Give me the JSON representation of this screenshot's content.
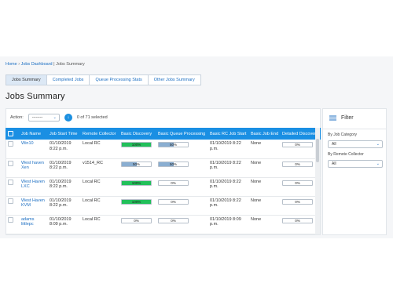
{
  "breadcrumb": {
    "home": "Home",
    "sep1": " › ",
    "dashboard": "Jobs Dashboard",
    "sep2": " | ",
    "current": "Jobs Summary"
  },
  "tabs": [
    {
      "label": "Jobs Summary"
    },
    {
      "label": "Completed Jobs"
    },
    {
      "label": "Queue Processing Stats"
    },
    {
      "label": "Other Jobs Summary"
    }
  ],
  "page_title": "Jobs Summary",
  "actionbar": {
    "label": "Action:",
    "select_value": "--------",
    "selected_text": "0 of 71 selected"
  },
  "table": {
    "columns": [
      "Job Name",
      "Job Start Time",
      "Remote Collector",
      "Basic Discovery",
      "Basic Queue Processing",
      "Basic RC Job Start",
      "Basic Job End",
      "Detailed Discovery"
    ],
    "rows": [
      {
        "name": "Win10",
        "start": "01/10/2019 8:22 p.m.",
        "collector": "Local RC",
        "basic_discovery": {
          "label": "100%",
          "value": 100,
          "color": "green"
        },
        "queue": {
          "label": "50%",
          "value": 50,
          "color": "blue"
        },
        "rc_start": "01/10/2019 8:22 p.m.",
        "job_end": "None",
        "detailed": {
          "label": "0%",
          "value": 0,
          "color": "blue"
        }
      },
      {
        "name": "West haven Xen",
        "start": "01/10/2019 8:22 p.m.",
        "collector": "v1514_RC",
        "basic_discovery": {
          "label": "50%",
          "value": 50,
          "color": "blue"
        },
        "queue": {
          "label": "50%",
          "value": 50,
          "color": "blue"
        },
        "rc_start": "01/10/2019 8:22 p.m.",
        "job_end": "None",
        "detailed": {
          "label": "0%",
          "value": 0,
          "color": "blue"
        }
      },
      {
        "name": "West Haven LXC",
        "start": "01/10/2019 8:22 p.m.",
        "collector": "Local RC",
        "basic_discovery": {
          "label": "100%",
          "value": 100,
          "color": "green"
        },
        "queue": {
          "label": "0%",
          "value": 0,
          "color": "blue"
        },
        "rc_start": "01/10/2019 8:22 p.m.",
        "job_end": "None",
        "detailed": {
          "label": "0%",
          "value": 0,
          "color": "blue"
        }
      },
      {
        "name": "West Haven KVM",
        "start": "01/10/2019 8:22 p.m.",
        "collector": "Local RC",
        "basic_discovery": {
          "label": "100%",
          "value": 100,
          "color": "green"
        },
        "queue": {
          "label": "0%",
          "value": 0,
          "color": "blue"
        },
        "rc_start": "01/10/2019 8:22 p.m.",
        "job_end": "None",
        "detailed": {
          "label": "0%",
          "value": 0,
          "color": "blue"
        }
      },
      {
        "name": "adams littlepc",
        "start": "01/10/2019 8:09 p.m.",
        "collector": "Local RC",
        "basic_discovery": {
          "label": "0%",
          "value": 0,
          "color": "blue"
        },
        "queue": {
          "label": "0%",
          "value": 0,
          "color": "blue"
        },
        "rc_start": "01/10/2019 8:09 p.m.",
        "job_end": "None",
        "detailed": {
          "label": "0%",
          "value": 0,
          "color": "blue"
        }
      }
    ]
  },
  "filter": {
    "title": "Filter",
    "category_label": "By Job Category",
    "category_value": "All",
    "collector_label": "By Remote Collector",
    "collector_value": "All"
  },
  "colors": {
    "accent": "#1a8fe3",
    "link": "#1b6ec2",
    "progress_green": "#22c05a",
    "progress_blue": "#8aaed1"
  }
}
